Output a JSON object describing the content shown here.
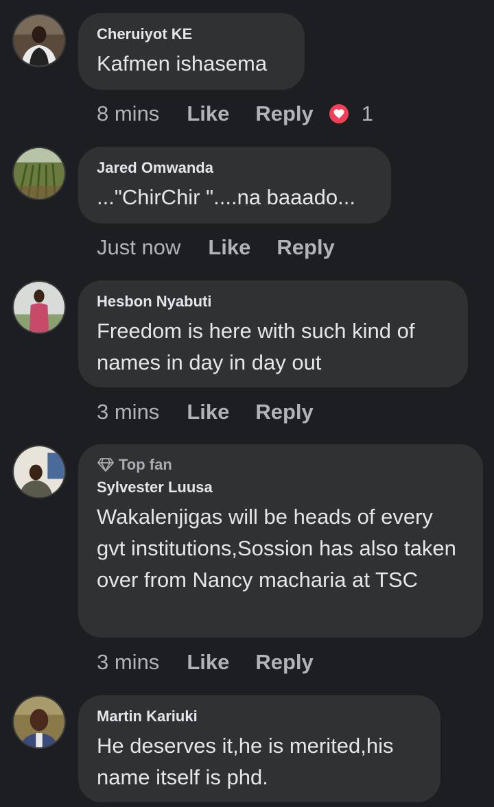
{
  "comments": [
    {
      "author": "Cheruiyot KE",
      "text": "Kafmen ishasema",
      "time": "8 mins",
      "like_label": "Like",
      "reply_label": "Reply",
      "reaction_count": "1",
      "reaction_icon": "heart-icon"
    },
    {
      "author": "Jared Omwanda",
      "text": "...\"ChirChir \"....na baaado...",
      "time": "Just now",
      "like_label": "Like",
      "reply_label": "Reply"
    },
    {
      "author": "Hesbon Nyabuti",
      "text": "Freedom is here with such kind of names in day in day out",
      "time": "3 mins",
      "like_label": "Like",
      "reply_label": "Reply"
    },
    {
      "badge": "Top fan",
      "badge_icon": "diamond-icon",
      "author": "Sylvester Luusa",
      "text": "Wakalenjigas will be heads of every gvt institutions,Sossion has also taken over from Nancy macharia at TSC",
      "time": "3 mins",
      "like_label": "Like",
      "reply_label": "Reply"
    },
    {
      "author": "Martin Kariuki",
      "text": "He deserves it,he is merited,his name itself is phd."
    }
  ],
  "colors": {
    "background": "#1c1e21",
    "bubble": "#2f3133",
    "text_primary": "#e4e6eb",
    "text_secondary": "#b0b3b8",
    "heart": "#f33e58"
  }
}
